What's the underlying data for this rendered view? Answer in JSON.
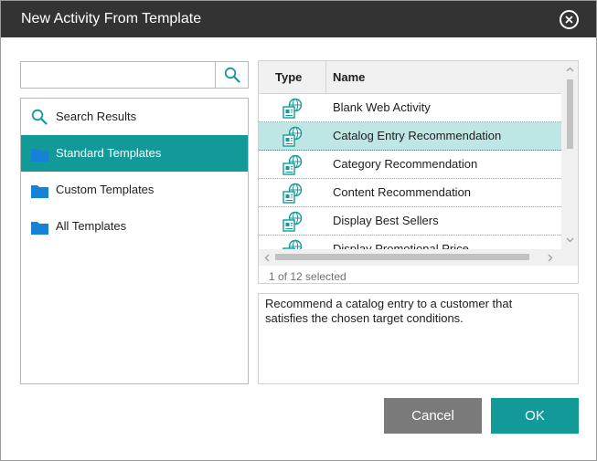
{
  "window": {
    "title": "New Activity From Template"
  },
  "search": {
    "value": "",
    "placeholder": ""
  },
  "nav": {
    "items": [
      {
        "label": "Search Results",
        "icon": "search-icon"
      },
      {
        "label": "Standard Templates",
        "icon": "folder-icon",
        "selected": true
      },
      {
        "label": "Custom Templates",
        "icon": "folder-icon"
      },
      {
        "label": "All Templates",
        "icon": "folder-icon"
      }
    ]
  },
  "grid": {
    "columns": [
      "Type",
      "Name"
    ],
    "rows": [
      {
        "name": "Blank Web Activity",
        "type_icon": "web-activity-icon"
      },
      {
        "name": "Catalog Entry Recommendation",
        "type_icon": "web-activity-icon",
        "selected": true
      },
      {
        "name": "Category Recommendation",
        "type_icon": "web-activity-icon"
      },
      {
        "name": "Content Recommendation",
        "type_icon": "web-activity-icon"
      },
      {
        "name": "Display Best Sellers",
        "type_icon": "web-activity-icon"
      },
      {
        "name": "Display Promotional Price",
        "type_icon": "web-activity-icon"
      }
    ],
    "selection_status": "1 of 12 selected"
  },
  "description": "Recommend a catalog entry to a customer that satisfies the chosen target conditions.",
  "buttons": {
    "cancel": "Cancel",
    "ok": "OK"
  },
  "colors": {
    "titlebar": "#333333",
    "accent": "#129a99",
    "row_selected": "#bde6e5",
    "folder": "#1582d8",
    "cancel": "#7a7a7a"
  }
}
